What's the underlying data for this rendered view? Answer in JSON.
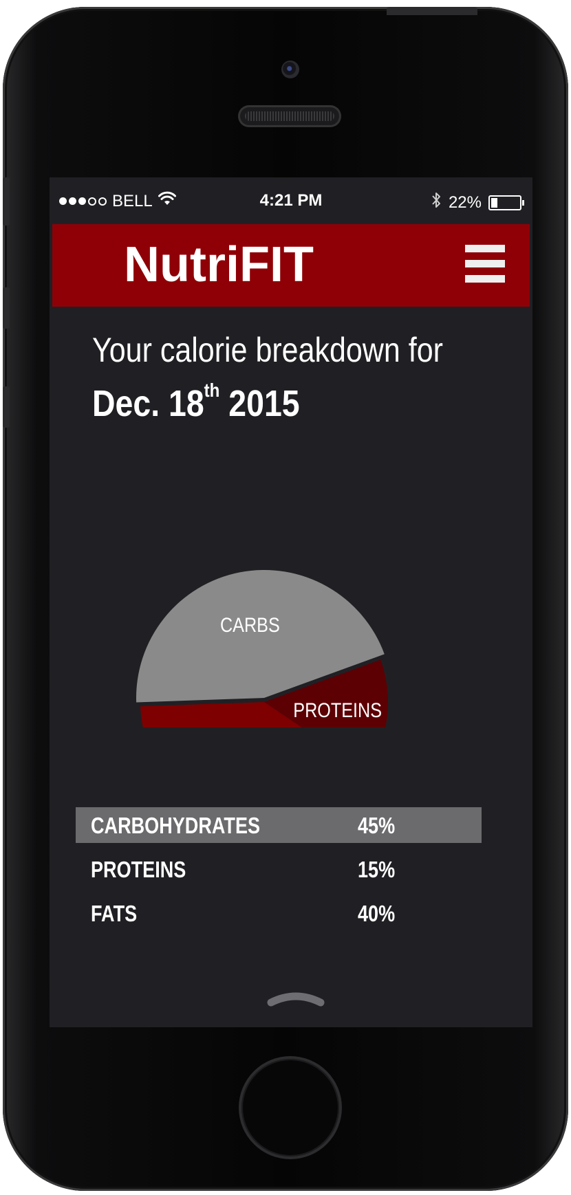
{
  "status_bar": {
    "carrier": "BELL",
    "signal_bars_filled": 3,
    "signal_bars_total": 5,
    "time": "4:21 PM",
    "battery_percent": "22%",
    "battery_level": 0.22,
    "icons": [
      "wifi-icon",
      "bluetooth-icon",
      "battery-icon"
    ]
  },
  "header": {
    "title": "NutriFIT",
    "menu_icon": "hamburger-menu-icon",
    "background_color": "#8e0006"
  },
  "heading": {
    "line1": "Your calorie breakdown for",
    "date_main": "Dec. 18",
    "date_suffix": "th",
    "date_year": " 2015"
  },
  "chart_data": {
    "type": "pie",
    "title": "",
    "slices": [
      {
        "label": "CARBS",
        "value": 45,
        "color": "#8a8a8a"
      },
      {
        "label": "PROTEINS",
        "value": 15,
        "color": "#5c0004"
      },
      {
        "label": "FATS",
        "value": 40,
        "color": "#7e0000"
      }
    ]
  },
  "breakdown": {
    "rows": [
      {
        "label": "CARBOHYDRATES",
        "value": "45%",
        "selected": true
      },
      {
        "label": "PROTEINS",
        "value": "15%",
        "selected": false
      },
      {
        "label": "FATS",
        "value": "40%",
        "selected": false
      }
    ]
  },
  "colors": {
    "screen_background": "#202024",
    "accent": "#8e0006",
    "selected_row": "#6b6b6e"
  }
}
